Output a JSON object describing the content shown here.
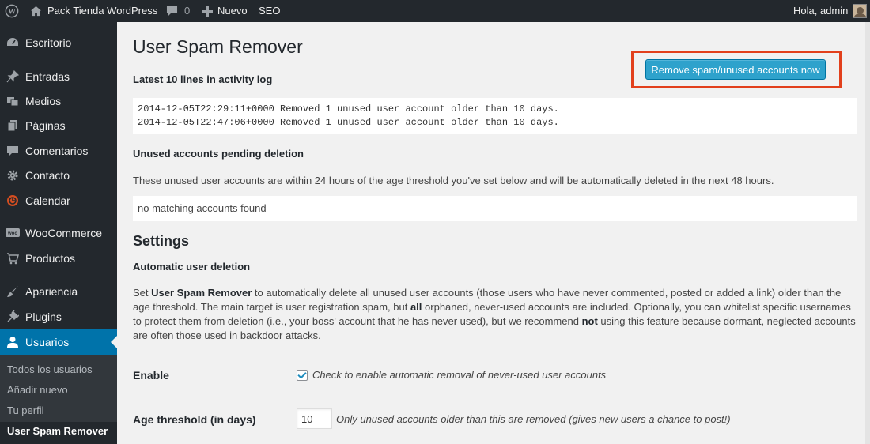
{
  "adminbar": {
    "site_name": "Pack Tienda WordPress",
    "comments_count": "0",
    "new_label": "Nuevo",
    "seo_label": "SEO",
    "greeting": "Hola, admin"
  },
  "sidebar": {
    "items": [
      {
        "label": "Escritorio",
        "icon": "dashboard-icon"
      },
      {
        "label": "Entradas",
        "icon": "pin-icon"
      },
      {
        "label": "Medios",
        "icon": "media-icon"
      },
      {
        "label": "Páginas",
        "icon": "pages-icon"
      },
      {
        "label": "Comentarios",
        "icon": "comments-icon"
      },
      {
        "label": "Contacto",
        "icon": "gear-icon"
      },
      {
        "label": "Calendar",
        "icon": "calendar-icon"
      },
      {
        "label": "WooCommerce",
        "icon": "woocommerce-icon"
      },
      {
        "label": "Productos",
        "icon": "cart-icon"
      },
      {
        "label": "Apariencia",
        "icon": "brush-icon"
      },
      {
        "label": "Plugins",
        "icon": "plugin-icon"
      },
      {
        "label": "Usuarios",
        "icon": "user-icon"
      }
    ],
    "submenu": [
      "Todos los usuarios",
      "Añadir nuevo",
      "Tu perfil",
      "User Spam Remover"
    ]
  },
  "main": {
    "title": "User Spam Remover",
    "remove_button": "Remove spam/unused accounts now",
    "log_heading": "Latest 10 lines in activity log",
    "log_lines": [
      "2014-12-05T22:29:11+0000 Removed 1 unused user account older than 10 days.",
      "2014-12-05T22:47:06+0000 Removed 1 unused user account older than 10 days."
    ],
    "pending_heading": "Unused accounts pending deletion",
    "pending_text": "These unused user accounts are within 24 hours of the age threshold you've set below and will be automatically deleted in the next 48 hours.",
    "no_matching": "no matching accounts found",
    "settings_heading": "Settings",
    "auto_heading": "Automatic user deletion",
    "para": {
      "p1": "Set ",
      "b1": "User Spam Remover",
      "p2": " to automatically delete all unused user accounts (those users who have never commented, posted or added a link) older than the age threshold. The main target is user registration spam, but ",
      "b2": "all",
      "p3": " orphaned, never-used accounts are included. Optionally, you can whitelist specific usernames to protect them from deletion (i.e., your boss' account that he has never used), but we recommend ",
      "b3": "not",
      "p4": " using this feature because dormant, neglected accounts are often those used in backdoor attacks."
    },
    "enable_label": "Enable",
    "enable_desc": "Check to enable automatic removal of never-used user accounts",
    "age_label": "Age threshold (in days)",
    "age_value": "10",
    "age_desc": "Only unused accounts older than this are removed (gives new users a chance to post!)"
  },
  "colors": {
    "admin_bg": "#23282d",
    "accent": "#0073aa",
    "button": "#2ea2cc",
    "highlight": "#e2401c"
  }
}
